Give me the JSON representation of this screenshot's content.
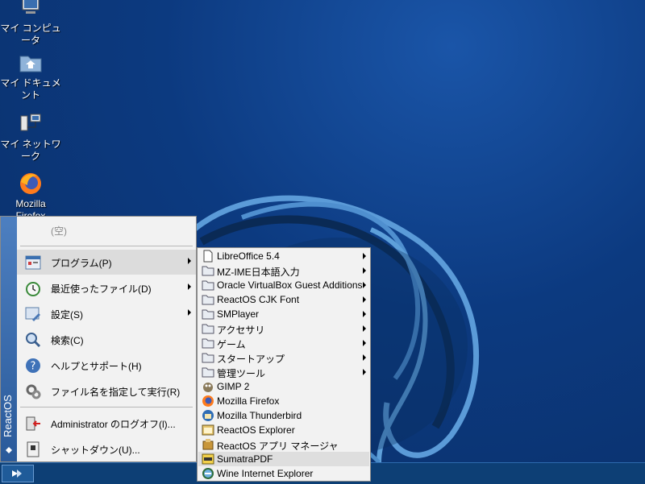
{
  "desktop": {
    "icons": [
      {
        "label": "マイ コンピュータ",
        "icon": "computer-icon"
      },
      {
        "label": "マイ ドキュメント",
        "icon": "documents-folder-icon"
      },
      {
        "label": "マイ ネットワーク",
        "icon": "network-icon"
      },
      {
        "label": "Mozilla Firefox",
        "icon": "firefox-icon"
      }
    ]
  },
  "start_menu": {
    "brand": "ReactOS",
    "empty_label": "(空)",
    "items": [
      {
        "label": "プログラム(P)",
        "icon": "programs-icon",
        "submenu": true
      },
      {
        "label": "最近使ったファイル(D)",
        "icon": "recent-documents-icon",
        "submenu": true
      },
      {
        "label": "設定(S)",
        "icon": "settings-icon",
        "submenu": true
      },
      {
        "label": "検索(C)",
        "icon": "search-icon",
        "submenu": false
      },
      {
        "label": "ヘルプとサポート(H)",
        "icon": "help-icon",
        "submenu": false
      },
      {
        "label": "ファイル名を指定して実行(R)",
        "icon": "run-icon",
        "submenu": false
      },
      {
        "label": "Administrator のログオフ(l)...",
        "icon": "logoff-icon",
        "submenu": false
      },
      {
        "label": "シャットダウン(U)...",
        "icon": "shutdown-icon",
        "submenu": false
      }
    ]
  },
  "programs_menu": {
    "items": [
      {
        "label": "LibreOffice 5.4",
        "icon": "folder-doc-icon",
        "submenu": true
      },
      {
        "label": "MZ-IME日本語入力",
        "icon": "folder-icon",
        "submenu": true
      },
      {
        "label": "Oracle VirtualBox Guest Additions",
        "icon": "folder-icon",
        "submenu": true
      },
      {
        "label": "ReactOS CJK Font",
        "icon": "folder-icon",
        "submenu": true
      },
      {
        "label": "SMPlayer",
        "icon": "folder-icon",
        "submenu": true
      },
      {
        "label": "アクセサリ",
        "icon": "folder-icon",
        "submenu": true
      },
      {
        "label": "ゲーム",
        "icon": "folder-icon",
        "submenu": true
      },
      {
        "label": "スタートアップ",
        "icon": "folder-icon",
        "submenu": true
      },
      {
        "label": "管理ツール",
        "icon": "folder-icon",
        "submenu": true
      },
      {
        "label": "GIMP 2",
        "icon": "gimp-icon",
        "submenu": false
      },
      {
        "label": "Mozilla Firefox",
        "icon": "firefox-icon",
        "submenu": false
      },
      {
        "label": "Mozilla Thunderbird",
        "icon": "thunderbird-icon",
        "submenu": false
      },
      {
        "label": "ReactOS Explorer",
        "icon": "explorer-icon",
        "submenu": false
      },
      {
        "label": "ReactOS アプリ マネージャ",
        "icon": "app-manager-icon",
        "submenu": false
      },
      {
        "label": "SumatraPDF",
        "icon": "sumatrapdf-icon",
        "submenu": false
      },
      {
        "label": "Wine Internet Explorer",
        "icon": "internet-explorer-icon",
        "submenu": false
      }
    ]
  }
}
